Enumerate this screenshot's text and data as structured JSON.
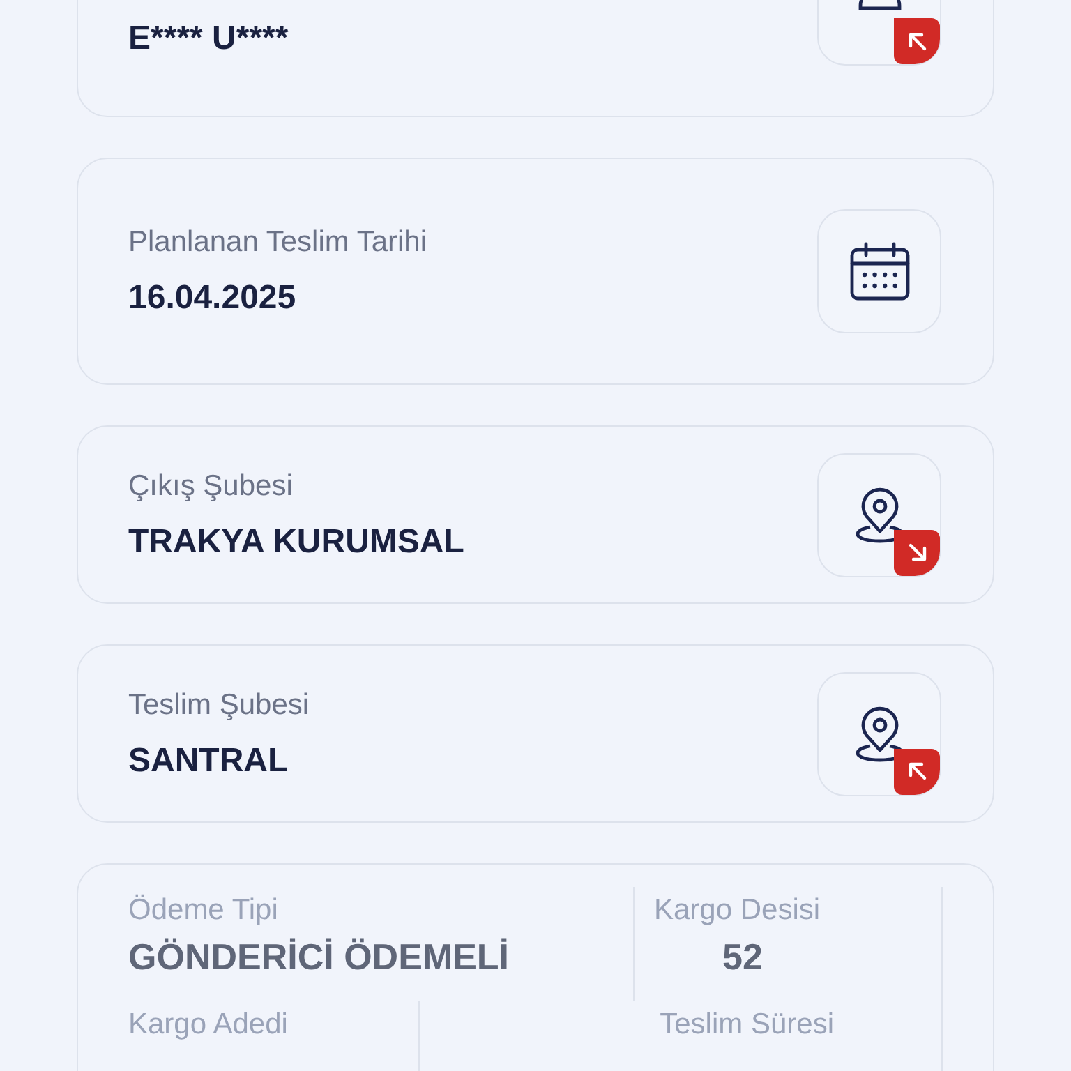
{
  "cards": [
    {
      "kind": "recipient",
      "value": "E**** U****"
    },
    {
      "kind": "date",
      "label": "Planlanan Teslim Tarihi",
      "value": "16.04.2025"
    },
    {
      "kind": "origin_branch",
      "label": "Çıkış Şubesi",
      "value": "TRAKYA KURUMSAL"
    },
    {
      "kind": "destination_branch",
      "label": "Teslim Şubesi",
      "value": "SANTRAL"
    }
  ],
  "summary": {
    "payment_type": {
      "label": "Ödeme Tipi",
      "value": "GÖNDERİCİ ÖDEMELİ"
    },
    "desi": {
      "label": "Kargo Desisi",
      "value": "52"
    },
    "count": {
      "label": "Kargo Adedi"
    },
    "duration": {
      "label": "Teslim Süresi"
    }
  }
}
